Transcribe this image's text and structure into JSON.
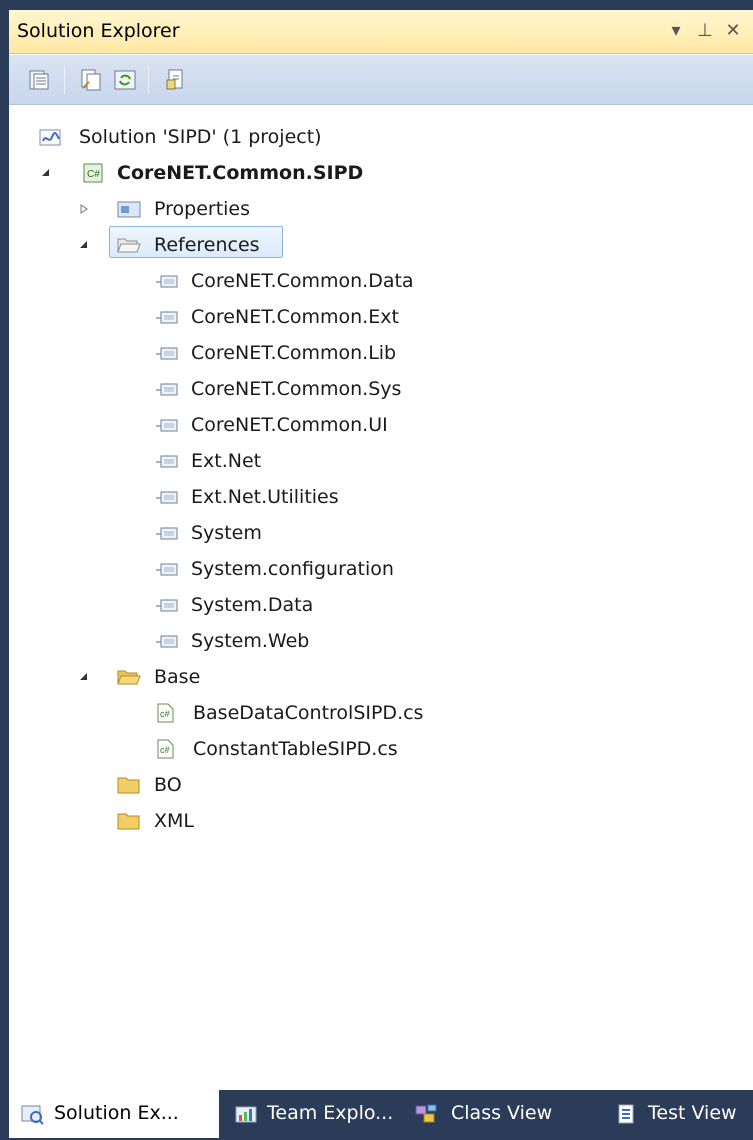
{
  "window": {
    "title": "Solution Explorer",
    "controls": {
      "dropdown": "▾",
      "pin": "⊥",
      "close": "✕"
    }
  },
  "toolbar": {
    "buttons": [
      "properties-icon",
      "show-all-files-icon",
      "refresh-icon",
      "view-class-diagram-icon"
    ]
  },
  "tree": {
    "solution": "Solution 'SIPD' (1 project)",
    "project": "CoreNET.Common.SIPD",
    "properties": "Properties",
    "references": {
      "label": "References",
      "items": [
        "CoreNET.Common.Data",
        "CoreNET.Common.Ext",
        "CoreNET.Common.Lib",
        "CoreNET.Common.Sys",
        "CoreNET.Common.UI",
        "Ext.Net",
        "Ext.Net.Utilities",
        "System",
        "System.configuration",
        "System.Data",
        "System.Web"
      ]
    },
    "base": {
      "label": "Base",
      "files": [
        "BaseDataControlSIPD.cs",
        "ConstantTableSIPD.cs"
      ]
    },
    "folders": [
      "BO",
      "XML"
    ]
  },
  "bottom_tabs": [
    {
      "label": "Solution Ex...",
      "active": true
    },
    {
      "label": "Team Explo...",
      "active": false
    },
    {
      "label": "Class View",
      "active": false
    },
    {
      "label": "Test View",
      "active": false
    }
  ]
}
